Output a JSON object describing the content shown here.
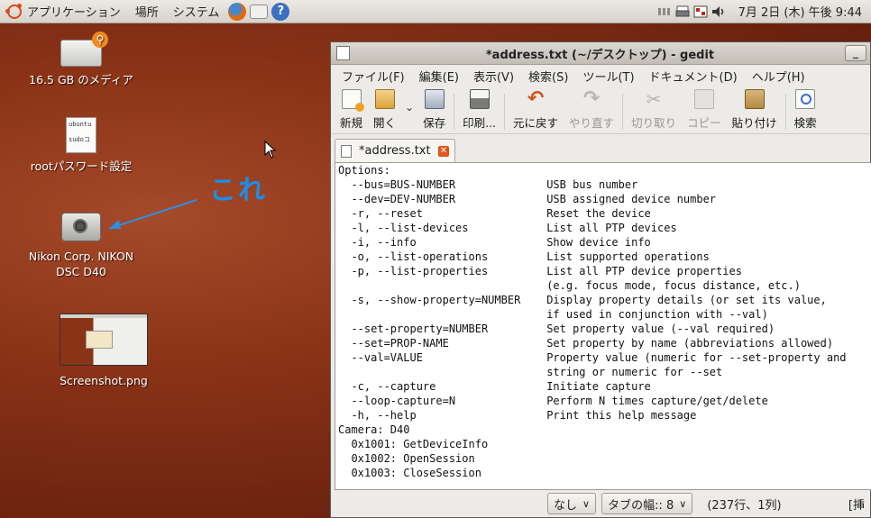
{
  "top_panel": {
    "applications": "アプリケーション",
    "places": "場所",
    "system": "システム",
    "clock": "7月 2日 (木) 午後 9:44"
  },
  "desktop": {
    "icons": [
      {
        "label": "16.5 GB のメディア"
      },
      {
        "label": "rootパスワード設定",
        "doc_text_1": "ubuntu",
        "doc_text_2": "sudoコ"
      },
      {
        "label_1": "Nikon Corp. NIKON",
        "label_2": "DSC D40"
      },
      {
        "label": "Screenshot.png"
      }
    ],
    "annotation": "これ"
  },
  "gedit": {
    "title": "*address.txt (~/デスクトップ) - gedit",
    "minimize": "_",
    "menu": [
      "ファイル(F)",
      "編集(E)",
      "表示(V)",
      "検索(S)",
      "ツール(T)",
      "ドキュメント(D)",
      "ヘルプ(H)"
    ],
    "toolbar": {
      "new": "新規",
      "open": "開く",
      "save": "保存",
      "print": "印刷...",
      "undo": "元に戻す",
      "redo": "やり直す",
      "cut": "切り取り",
      "copy": "コピー",
      "paste": "貼り付け",
      "find": "検索",
      "dropdown": "⌄"
    },
    "tab": {
      "label": "*address.txt",
      "close": "✕"
    },
    "lines": [
      "Options:",
      "  --bus=BUS-NUMBER              USB bus number",
      "  --dev=DEV-NUMBER              USB assigned device number",
      "  -r, --reset                   Reset the device",
      "  -l, --list-devices            List all PTP devices",
      "  -i, --info                    Show device info",
      "  -o, --list-operations         List supported operations",
      "  -p, --list-properties         List all PTP device properties",
      "                                (e.g. focus mode, focus distance, etc.)",
      "  -s, --show-property=NUMBER    Display property details (or set its value,",
      "                                if used in conjunction with --val)",
      "  --set-property=NUMBER         Set property value (--val required)",
      "  --set=PROP-NAME               Set property by name (abbreviations allowed)",
      "  --val=VALUE                   Property value (numeric for --set-property and",
      "                                string or numeric for --set",
      "  -c, --capture                 Initiate capture",
      "  --loop-capture=N              Perform N times capture/get/delete",
      "  -h, --help                    Print this help message",
      "",
      "Camera: D40",
      "  0x1001: GetDeviceInfo",
      "  0x1002: OpenSession",
      "  0x1003: CloseSession"
    ],
    "status": {
      "highlight_mode": "なし",
      "tab_width": "タブの幅:: 8",
      "position": "(237行、1列)",
      "insert_mode": "[挿"
    }
  }
}
